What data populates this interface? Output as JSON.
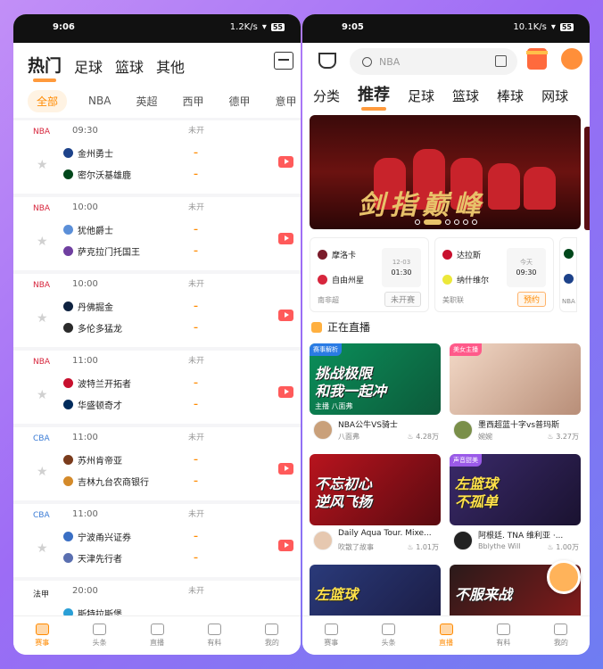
{
  "left": {
    "status": {
      "time": "9:06",
      "net": "1.2K/s",
      "battery": "55"
    },
    "categories": [
      "热门",
      "足球",
      "篮球",
      "其他"
    ],
    "leagues": [
      "全部",
      "NBA",
      "英超",
      "西甲",
      "德甲",
      "意甲"
    ],
    "status_label": "未开",
    "score_dash": "–",
    "matches": [
      {
        "league": "NBA",
        "time": "09:30",
        "home": "金州勇士",
        "away": "密尔沃基雄鹿"
      },
      {
        "league": "NBA",
        "time": "10:00",
        "home": "犹他爵士",
        "away": "萨克拉门托国王"
      },
      {
        "league": "NBA",
        "time": "10:00",
        "home": "丹佛掘金",
        "away": "多伦多猛龙"
      },
      {
        "league": "NBA",
        "time": "11:00",
        "home": "波特兰开拓者",
        "away": "华盛顿奇才"
      },
      {
        "league": "CBA",
        "time": "11:00",
        "home": "苏州肯帝亚",
        "away": "吉林九台农商银行"
      },
      {
        "league": "CBA",
        "time": "11:00",
        "home": "宁波甬兴证券",
        "away": "天津先行者"
      },
      {
        "league": "法甲",
        "time": "20:00",
        "home": "斯特拉斯堡",
        "away": ""
      }
    ],
    "tabs": [
      "赛事",
      "头条",
      "直播",
      "有料",
      "我的"
    ]
  },
  "right": {
    "status": {
      "time": "9:05",
      "net": "10.1K/s",
      "battery": "55"
    },
    "search_placeholder": "NBA",
    "categories": [
      "分类",
      "推荐",
      "足球",
      "篮球",
      "棒球",
      "网球"
    ],
    "banner_text": "剑指巅峰",
    "cards": [
      {
        "home": "摩洛卡",
        "away": "自由州星",
        "league": "南非超",
        "date": "12-03",
        "time": "01:30",
        "button": "未开赛"
      },
      {
        "home": "达拉斯",
        "away": "纳什维尔",
        "league": "美职联",
        "date": "今天",
        "time": "09:30",
        "button": "预约"
      },
      {
        "league": "NBA"
      }
    ],
    "live_header": "正在直播",
    "streams": [
      {
        "badge": "赛事解析",
        "big": "挑战极限\n和我一起冲",
        "sub": "主播 八面弗",
        "title": "NBA公牛VS骑士",
        "name": "八面弗",
        "heat": "4.28万"
      },
      {
        "badge": "美女主播",
        "big": "",
        "sub": "",
        "title": "墨西超蓝十字vs普玛斯",
        "name": "婉婉",
        "heat": "3.27万"
      },
      {
        "badge": "",
        "big": "不忘初心\n逆风飞扬",
        "sub": "",
        "title": "Daily Aqua Tour. Mixe...",
        "name": "吹散了故事",
        "heat": "1.01万"
      },
      {
        "badge": "声音甜美",
        "big": "左篮球\n不孤单",
        "sub": "",
        "title": "阿根廷. TNA 维利亚 ·...",
        "name": "Bblythe Will",
        "heat": "1.00万"
      },
      {
        "badge": "",
        "big": "左篮球",
        "sub": "",
        "title": "",
        "name": "",
        "heat": ""
      },
      {
        "badge": "",
        "big": "不服来战",
        "sub": "",
        "title": "",
        "name": "",
        "heat": ""
      }
    ],
    "tabs": [
      "赛事",
      "头条",
      "直播",
      "有料",
      "我的"
    ]
  }
}
